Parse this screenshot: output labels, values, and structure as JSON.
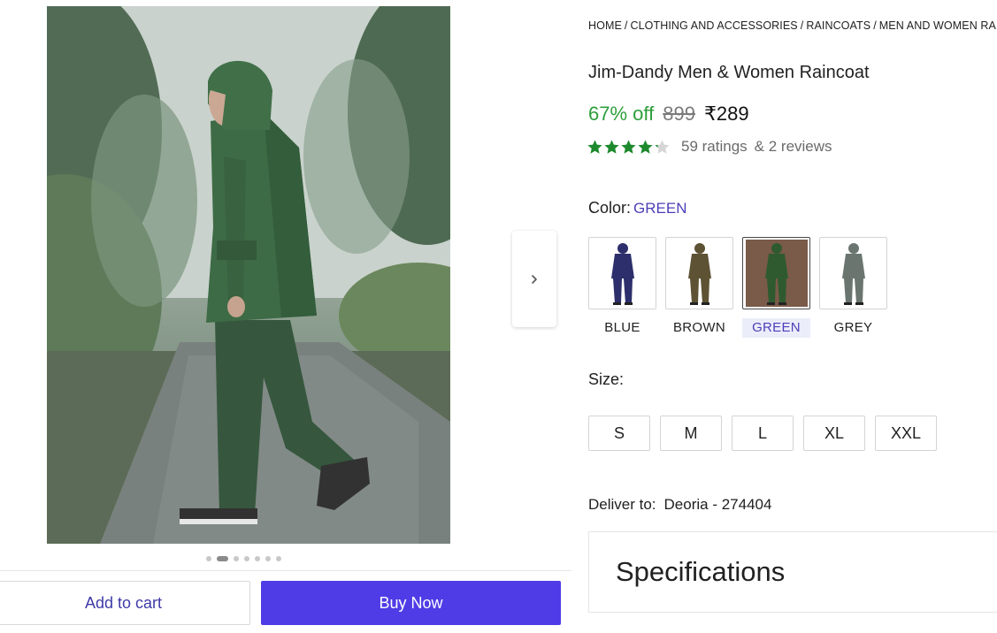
{
  "breadcrumb": [
    "HOME",
    "CLOTHING AND ACCESSORIES",
    "RAINCOATS",
    "MEN AND WOMEN RAINCOATS"
  ],
  "product": {
    "title": "Jim-Dandy Men & Women Raincoat",
    "discount": "67% off",
    "mrp": "899",
    "price": "₹289",
    "rating_value": 4.2,
    "ratings_text": "59 ratings",
    "reviews_text": "& 2 reviews"
  },
  "color": {
    "label": "Color:",
    "selected": "GREEN",
    "options": [
      {
        "name": "BLUE",
        "hex": "#2c2f6b"
      },
      {
        "name": "BROWN",
        "hex": "#5e5235"
      },
      {
        "name": "GREEN",
        "hex": "#2f5a30"
      },
      {
        "name": "GREY",
        "hex": "#6a7570"
      }
    ]
  },
  "size": {
    "label": "Size:",
    "options": [
      "S",
      "M",
      "L",
      "XL",
      "XXL"
    ]
  },
  "delivery": {
    "label": "Deliver to:",
    "location": "Deoria - 274404"
  },
  "specifications": {
    "heading": "Specifications"
  },
  "gallery": {
    "image_count": 7,
    "active_index": 1
  },
  "actions": {
    "add_to_cart": "Add to cart",
    "buy_now": "Buy Now"
  },
  "colors": {
    "accent": "#4f3ce6",
    "discount_green": "#2e9e3b",
    "star_green": "#1e8a2e",
    "selected_text": "#4b3fb8"
  },
  "icons": {
    "next": "chevron-right-icon",
    "star": "star-icon"
  }
}
